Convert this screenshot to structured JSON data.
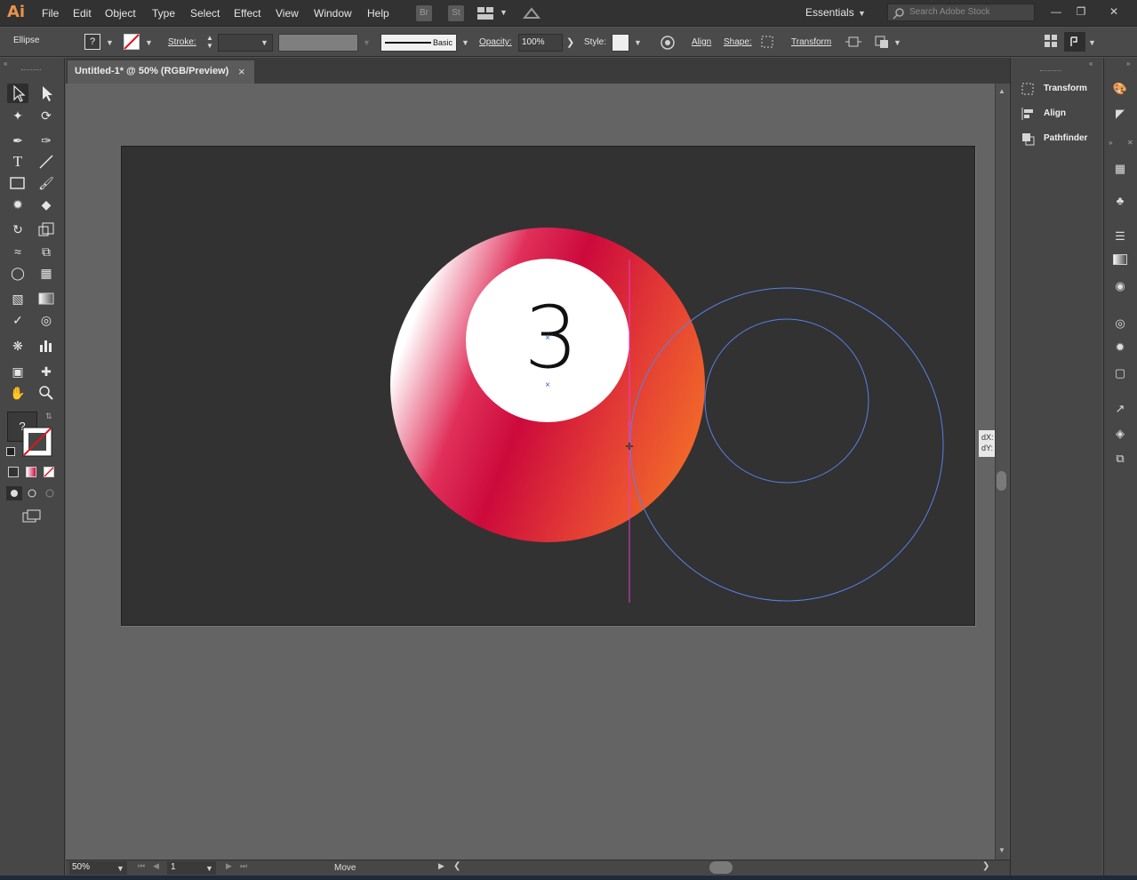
{
  "app": {
    "logo": "Ai"
  },
  "menu": [
    "File",
    "Edit",
    "Object",
    "Type",
    "Select",
    "Effect",
    "View",
    "Window",
    "Help"
  ],
  "menubar_icons": {
    "bridge": "Br",
    "stock": "St"
  },
  "workspace": "Essentials",
  "search": {
    "placeholder": "Search Adobe Stock"
  },
  "window_controls": {
    "minimize": "—",
    "restore": "❐",
    "close": "✕"
  },
  "control_bar": {
    "selection": "Ellipse",
    "stroke_label": "Stroke:",
    "brush": "Basic",
    "opacity_label": "Opacity:",
    "opacity_value": "100%",
    "style_label": "Style:",
    "align": "Align",
    "shape": "Shape:",
    "transform": "Transform"
  },
  "document": {
    "tab_title": "Untitled-1* @ 50% (RGB/Preview)",
    "close": "×"
  },
  "artwork": {
    "ball_number": "3",
    "ball_gradient": [
      "#ffffff",
      "#e0305a",
      "#cc0a3c",
      "#e33d35",
      "#f0652a"
    ]
  },
  "status_bar": {
    "zoom": "50%",
    "page": "1",
    "status": "Move"
  },
  "panels": [
    {
      "name": "Transform",
      "icon": "transform-icon"
    },
    {
      "name": "Align",
      "icon": "align-icon"
    },
    {
      "name": "Pathfinder",
      "icon": "pathfinder-icon"
    }
  ],
  "fill_stroke": {
    "fill_unknown": "?"
  },
  "measure": {
    "dx": "dX:",
    "dy": "dY:"
  }
}
